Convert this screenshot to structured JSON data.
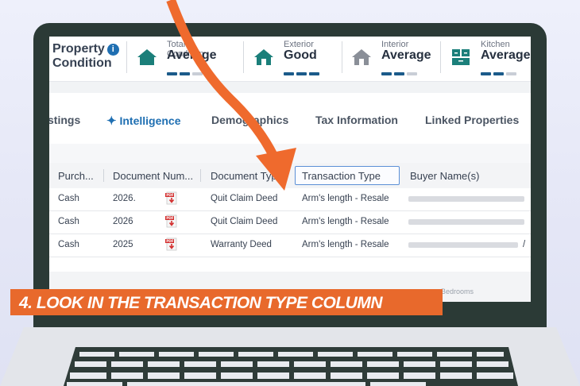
{
  "condition": {
    "title_line1": "Property",
    "title_line2": "Condition",
    "info_glyph": "i",
    "items": [
      {
        "sublabel": "Total Condition",
        "value": "Average",
        "icon": "house-icon",
        "icon_color": "#1b7f7a",
        "level": 2,
        "max": 4
      },
      {
        "sublabel": "Exterior",
        "value": "Good",
        "icon": "house-icon",
        "icon_color": "#1b7f7a",
        "level": 4,
        "max": 4
      },
      {
        "sublabel": "Interior",
        "value": "Average",
        "icon": "house-icon",
        "icon_color": "#8a8f98",
        "level": 2,
        "max": 4
      },
      {
        "sublabel": "Kitchen",
        "value": "Average",
        "icon": "kitchen-icon",
        "icon_color": "#1b7f7a",
        "level": 2,
        "max": 4
      }
    ]
  },
  "tabs": [
    {
      "label": "stings"
    },
    {
      "label": "Intelligence",
      "active": true,
      "icon": "sparkle-icon"
    },
    {
      "label": "Demographics"
    },
    {
      "label": "Tax Information"
    },
    {
      "label": "Linked Properties"
    }
  ],
  "table": {
    "headers": [
      "Purch...",
      "Document Num...",
      "Document Type",
      "Transaction Type",
      "Buyer Name(s)"
    ],
    "rows": [
      {
        "purchase": "Cash",
        "doc_num": "2026.",
        "doc_type": "Quit Claim Deed",
        "transaction": "Arm's length - Resale"
      },
      {
        "purchase": "Cash",
        "doc_num": "2026",
        "doc_type": "Quit Claim Deed",
        "transaction": "Arm's length - Resale"
      },
      {
        "purchase": "Cash",
        "doc_num": "2025",
        "doc_type": "Warranty Deed",
        "transaction": "Arm's length - Resale",
        "buyer_suffix": "/"
      }
    ]
  },
  "footer_partial": "Bedrooms",
  "banner": "4.  LOOK IN THE TRANSACTION TYPE COLUMN",
  "colors": {
    "accent": "#1f6fb2",
    "banner": "#e8692c",
    "arrow": "#ef6a2d",
    "highlight": "#5b8fd6"
  }
}
